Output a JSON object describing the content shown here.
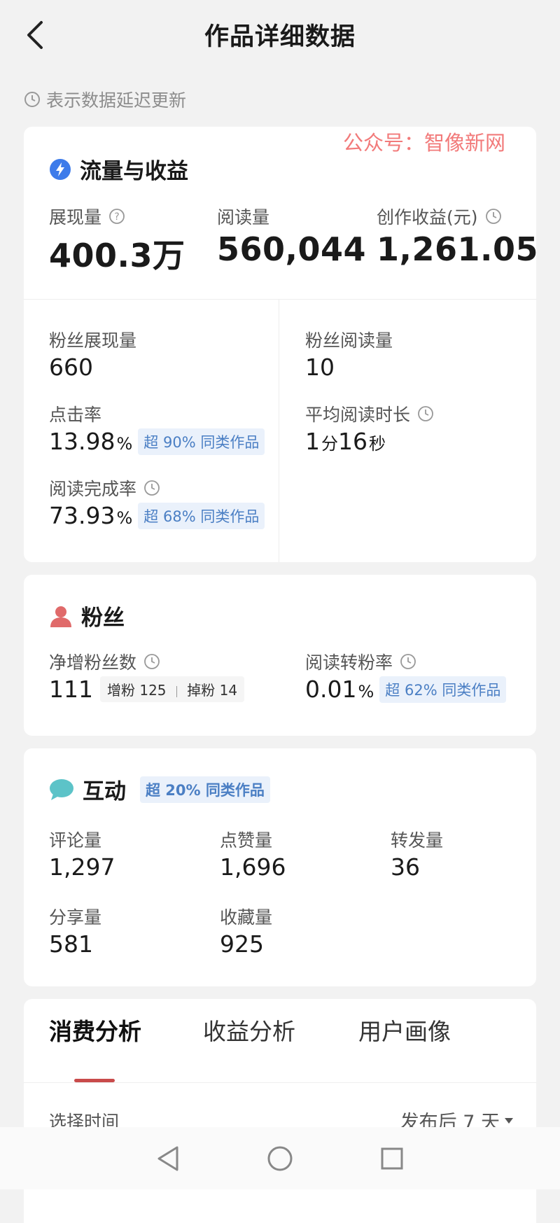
{
  "header": {
    "title": "作品详细数据"
  },
  "notice": "表示数据延迟更新",
  "watermark": "公众号：智像新网",
  "traffic": {
    "title": "流量与收益",
    "impressions": {
      "label": "展现量",
      "value": "400.3万"
    },
    "reads": {
      "label": "阅读量",
      "value": "560,044"
    },
    "earnings": {
      "label": "创作收益(元)",
      "value": "1,261.05"
    },
    "fan_impressions": {
      "label": "粉丝展现量",
      "value": "660"
    },
    "fan_reads": {
      "label": "粉丝阅读量",
      "value": "10"
    },
    "ctr": {
      "label": "点击率",
      "value": "13.98",
      "unit": "%",
      "badge": "超 90% 同类作品"
    },
    "avg_read_time": {
      "label": "平均阅读时长",
      "min": "1",
      "min_unit": "分",
      "sec": "16",
      "sec_unit": "秒"
    },
    "completion": {
      "label": "阅读完成率",
      "value": "73.93",
      "unit": "%",
      "badge": "超 68% 同类作品"
    }
  },
  "fans": {
    "title": "粉丝",
    "net_gain": {
      "label": "净增粉丝数",
      "value": "111",
      "gain_label": "增粉",
      "gain": "125",
      "loss_label": "掉粉",
      "loss": "14"
    },
    "conversion": {
      "label": "阅读转粉率",
      "value": "0.01",
      "unit": "%",
      "badge": "超 62% 同类作品"
    }
  },
  "interaction": {
    "title": "互动",
    "badge": "超 20% 同类作品",
    "comments": {
      "label": "评论量",
      "value": "1,297"
    },
    "likes": {
      "label": "点赞量",
      "value": "1,696"
    },
    "reposts": {
      "label": "转发量",
      "value": "36"
    },
    "shares": {
      "label": "分享量",
      "value": "581"
    },
    "favorites": {
      "label": "收藏量",
      "value": "925"
    }
  },
  "tabs": {
    "items": [
      {
        "label": "消费分析"
      },
      {
        "label": "收益分析"
      },
      {
        "label": "用户画像"
      }
    ],
    "active_index": 0,
    "select_label": "选择时间",
    "select_value": "发布后 7 天"
  },
  "colors": {
    "accent_red": "#c94b4b",
    "badge_blue": "#4b7fc4",
    "watermark": "#f27a7a",
    "icon_blue": "#3d7bea"
  }
}
